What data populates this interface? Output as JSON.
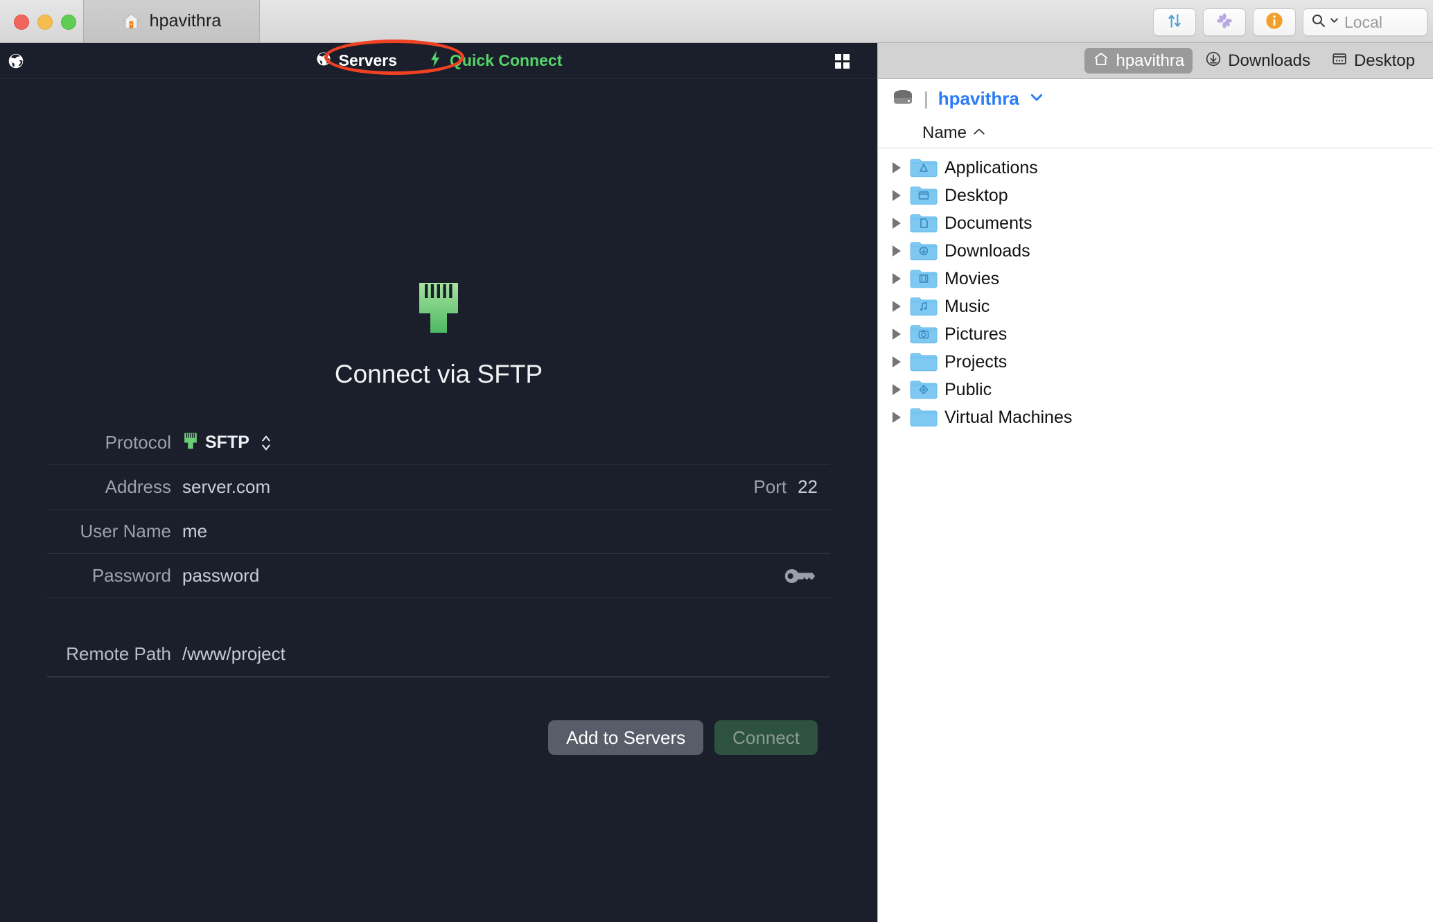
{
  "window": {
    "traffic_lights": [
      "close",
      "minimize",
      "maximize"
    ],
    "tab": {
      "title": "hpavithra",
      "icon": "home-icon"
    },
    "toolbar_buttons": [
      {
        "name": "transfers-button",
        "icon": "up-down-arrows-icon"
      },
      {
        "name": "activity-button",
        "icon": "pinwheel-icon"
      },
      {
        "name": "info-button",
        "icon": "info-circle-icon"
      }
    ],
    "search": {
      "icon": "search-icon",
      "placeholder": "Local",
      "value": ""
    }
  },
  "nav": {
    "globe_icon": "globe-icon",
    "items": [
      {
        "label": "Servers",
        "icon": "globe-icon",
        "accent": false
      },
      {
        "label": "Quick Connect",
        "icon": "lightning-bolt-icon",
        "accent": true
      }
    ],
    "grid_icon": "grid-view-icon",
    "annotation": {
      "shape": "ellipse",
      "color": "#f04123",
      "target": "Quick Connect"
    }
  },
  "connect_panel": {
    "hero_icon": "rj45-connector-icon",
    "hero_title": "Connect via SFTP",
    "fields": [
      {
        "label": "Protocol",
        "value": "SFTP",
        "type": "select",
        "icon": "rj45-connector-icon"
      },
      {
        "label": "Address",
        "value": "server.com",
        "type": "text"
      },
      {
        "label": "User Name",
        "value": "me",
        "type": "text"
      },
      {
        "label": "Password",
        "value": "password",
        "type": "password",
        "trailing_icon": "key-icon"
      }
    ],
    "port": {
      "label": "Port",
      "value": "22"
    },
    "remote_path": {
      "label": "Remote Path",
      "value": "/www/project"
    },
    "buttons": [
      {
        "label": "Add to Servers",
        "style": "gray"
      },
      {
        "label": "Connect",
        "style": "green-disabled"
      }
    ]
  },
  "browser": {
    "breadcrumbs": [
      {
        "label": "hpavithra",
        "icon": "home-icon",
        "active": true
      },
      {
        "label": "Downloads",
        "icon": "download-circle-icon",
        "active": false
      },
      {
        "label": "Desktop",
        "icon": "desktop-window-icon",
        "active": false
      }
    ],
    "location": {
      "disk_icon": "hard-drive-icon",
      "separator": "|",
      "name": "hpavithra",
      "caret": "chevron-down-icon"
    },
    "column_header": {
      "label": "Name",
      "sort": "ascending",
      "sort_icon": "chevron-up-icon"
    },
    "files": [
      {
        "name": "Applications",
        "icon": "folder-applications-icon"
      },
      {
        "name": "Desktop",
        "icon": "folder-desktop-icon"
      },
      {
        "name": "Documents",
        "icon": "folder-documents-icon"
      },
      {
        "name": "Downloads",
        "icon": "folder-downloads-icon"
      },
      {
        "name": "Movies",
        "icon": "folder-movies-icon"
      },
      {
        "name": "Music",
        "icon": "folder-music-icon"
      },
      {
        "name": "Pictures",
        "icon": "folder-pictures-icon"
      },
      {
        "name": "Projects",
        "icon": "folder-plain-icon"
      },
      {
        "name": "Public",
        "icon": "folder-public-icon"
      },
      {
        "name": "Virtual Machines",
        "icon": "folder-plain-icon"
      }
    ]
  },
  "colors": {
    "panel_bg": "#1b1f2b",
    "accent_green": "#55d46a",
    "annotation_red": "#f04123",
    "link_blue": "#2b7cf6",
    "folder_blue": "#76c3f0"
  }
}
